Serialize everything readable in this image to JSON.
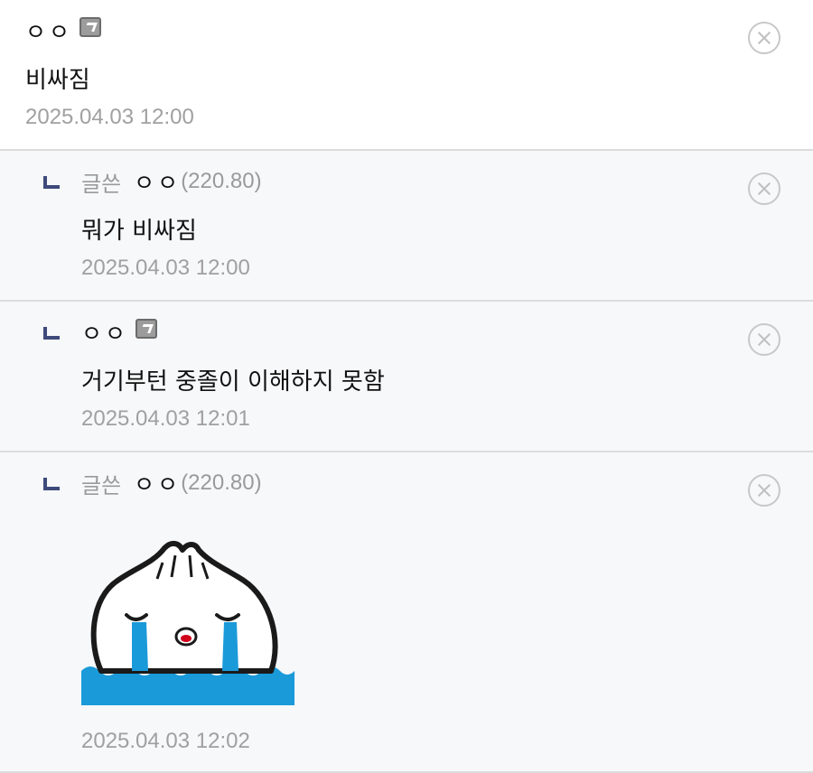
{
  "comments": [
    {
      "nickname": "ㅇㅇ",
      "body": "비싸짐",
      "timestamp": "2025.04.03 12:00"
    },
    {
      "writer_tag": "글쓴",
      "nickname": "ㅇㅇ",
      "ip": "(220.80)",
      "body": "뭐가 비싸짐",
      "timestamp": "2025.04.03 12:00"
    },
    {
      "nickname": "ㅇㅇ",
      "body": "거기부턴 중졸이 이해하지 못함",
      "timestamp": "2025.04.03 12:01"
    },
    {
      "writer_tag": "글쓴",
      "nickname": "ㅇㅇ",
      "ip": "(220.80)",
      "sticker": "crying-dumpling-sticker",
      "timestamp": "2025.04.03 12:02"
    }
  ],
  "icons": {
    "delete": "close-circle-icon",
    "reply": "reply-arrow-icon",
    "badge": "fixed-nick-badge-icon"
  },
  "colors": {
    "reply_arrow": "#3d4a7a",
    "meta_gray": "#9a9a9a",
    "reply_bg": "#f7f8fa",
    "sticker_water": "#1a9ad9"
  }
}
